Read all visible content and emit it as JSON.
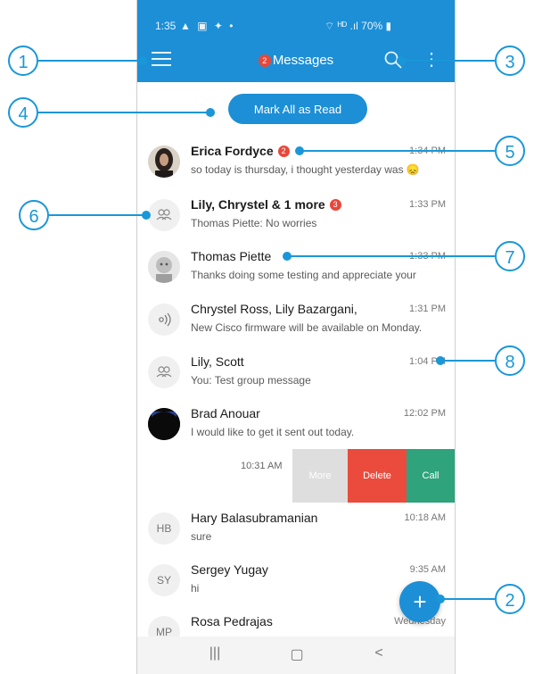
{
  "status_bar": {
    "time": "1:35",
    "icons": "▲ ▣ ✦ •",
    "right": "⌔ ᴴᴰ .ıl 70% ▮"
  },
  "app_bar": {
    "title": "Messages",
    "unread_badge": "2"
  },
  "mark_all_label": "Mark All as Read",
  "conversations": [
    {
      "name": "Erica Fordyce",
      "badge": "2",
      "time": "1:34 PM",
      "preview": "so today is thursday, i thought yesterday was 😞"
    },
    {
      "name": "Lily, Chrystel & 1 more",
      "badge": "3",
      "time": "1:33 PM",
      "preview": "Thomas Piette: No worries"
    },
    {
      "name": "Thomas Piette",
      "time": "1:33 PM",
      "preview": "Thanks doing some testing and appreciate your"
    },
    {
      "name": "Chrystel Ross, Lily Bazargani,",
      "time": "1:31 PM",
      "preview": "New Cisco firmware will be available on Monday."
    },
    {
      "name": "Lily, Scott",
      "time": "1:04 PM",
      "preview": "You: Test group message"
    },
    {
      "name": "Brad Anouar",
      "time": "12:02 PM",
      "preview": "I would like to get it sent out today."
    },
    {
      "name": "Hary Balasubramanian",
      "initials": "HB",
      "time": "10:18 AM",
      "preview": "sure"
    },
    {
      "name": "Sergey Yugay",
      "initials": "SY",
      "time": "9:35 AM",
      "preview": "hi"
    },
    {
      "name": "Rosa Pedrajas",
      "initials": "MP",
      "time": "Wednesday",
      "preview": ""
    }
  ],
  "swipe_row": {
    "time": "10:31 AM",
    "more_label": "More",
    "delete_label": "Delete",
    "call_label": "Call"
  },
  "fab_label": "+",
  "nav": {
    "recent": "|||",
    "home": "▢",
    "back": "<"
  },
  "callouts": [
    "1",
    "2",
    "3",
    "4",
    "5",
    "6",
    "7",
    "8"
  ],
  "colors": {
    "brand": "#1c8fd6",
    "badge": "#e8473a",
    "delete": "#ea4b3d",
    "call": "#2fa37b",
    "callout": "#1a97d8"
  },
  "icons": [
    "menu-icon",
    "search-icon",
    "more-vert-icon",
    "group-icon",
    "audio-icon",
    "plus-icon"
  ]
}
